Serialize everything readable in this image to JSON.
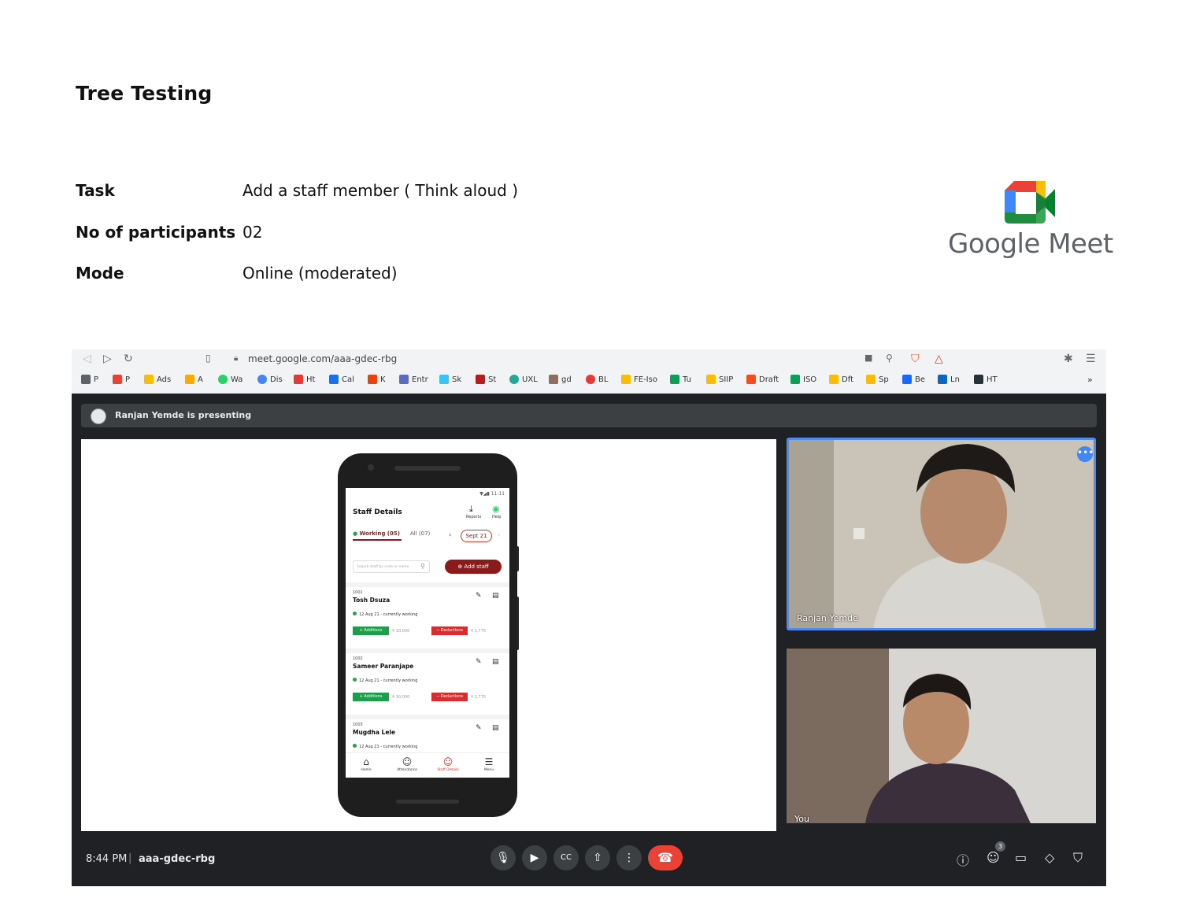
{
  "page": {
    "title": "Tree Testing",
    "rows": [
      {
        "label": "Task",
        "value": "Add a staff member ( Think aloud )"
      },
      {
        "label": "No of participants",
        "value": "02"
      },
      {
        "label": "Mode",
        "value": "Online (moderated)"
      }
    ],
    "logo_text": "Google Meet"
  },
  "browser": {
    "url": "meet.google.com/aaa-gdec-rbg",
    "bookmarks": [
      "P",
      "P",
      "Ads",
      "A",
      "Wa",
      "Dis",
      "Ht",
      "Cal",
      "K",
      "Entr",
      "Sk",
      "St",
      "UXL",
      "gd",
      "BL",
      "FE-Iso",
      "Tu",
      "SIIP",
      "Draft",
      "ISO",
      "Dft",
      "Sp",
      "Be",
      "Ln",
      "HT"
    ],
    "overflow": "»"
  },
  "meet": {
    "presenting": "Ranjan Yemde is presenting",
    "time": "8:44 PM",
    "divider": "|",
    "code": "aaa-gdec-rbg",
    "tile1_name": "Ranjan Yemde",
    "tile2_name": "You",
    "people_count": "3"
  },
  "app": {
    "status": "11:11",
    "title": "Staff Details",
    "reports": "Reports",
    "help": "Help",
    "tab_working": "Working (05)",
    "tab_all": "All (07)",
    "month": "Sept 21",
    "search_placeholder": "Search staff by code or name",
    "add_staff": "Add staff",
    "staff": [
      {
        "code": "1001",
        "name": "Tosh Dsuza",
        "status": "12 Aug 21 - currently working",
        "add": "Additions",
        "add_amt": "₹ 30,000",
        "ded": "Deductions",
        "ded_amt": "₹ 1,775"
      },
      {
        "code": "1002",
        "name": "Sameer Paranjape",
        "status": "12 Aug 21 - currently working",
        "add": "Additions",
        "add_amt": "₹ 30,000",
        "ded": "Deductions",
        "ded_amt": "₹ 1,775"
      },
      {
        "code": "1003",
        "name": "Mugdha Lele",
        "status": "12 Aug 21 - currently working"
      }
    ],
    "nav": [
      "Home",
      "Attendance",
      "Staff Details",
      "Menu"
    ]
  }
}
